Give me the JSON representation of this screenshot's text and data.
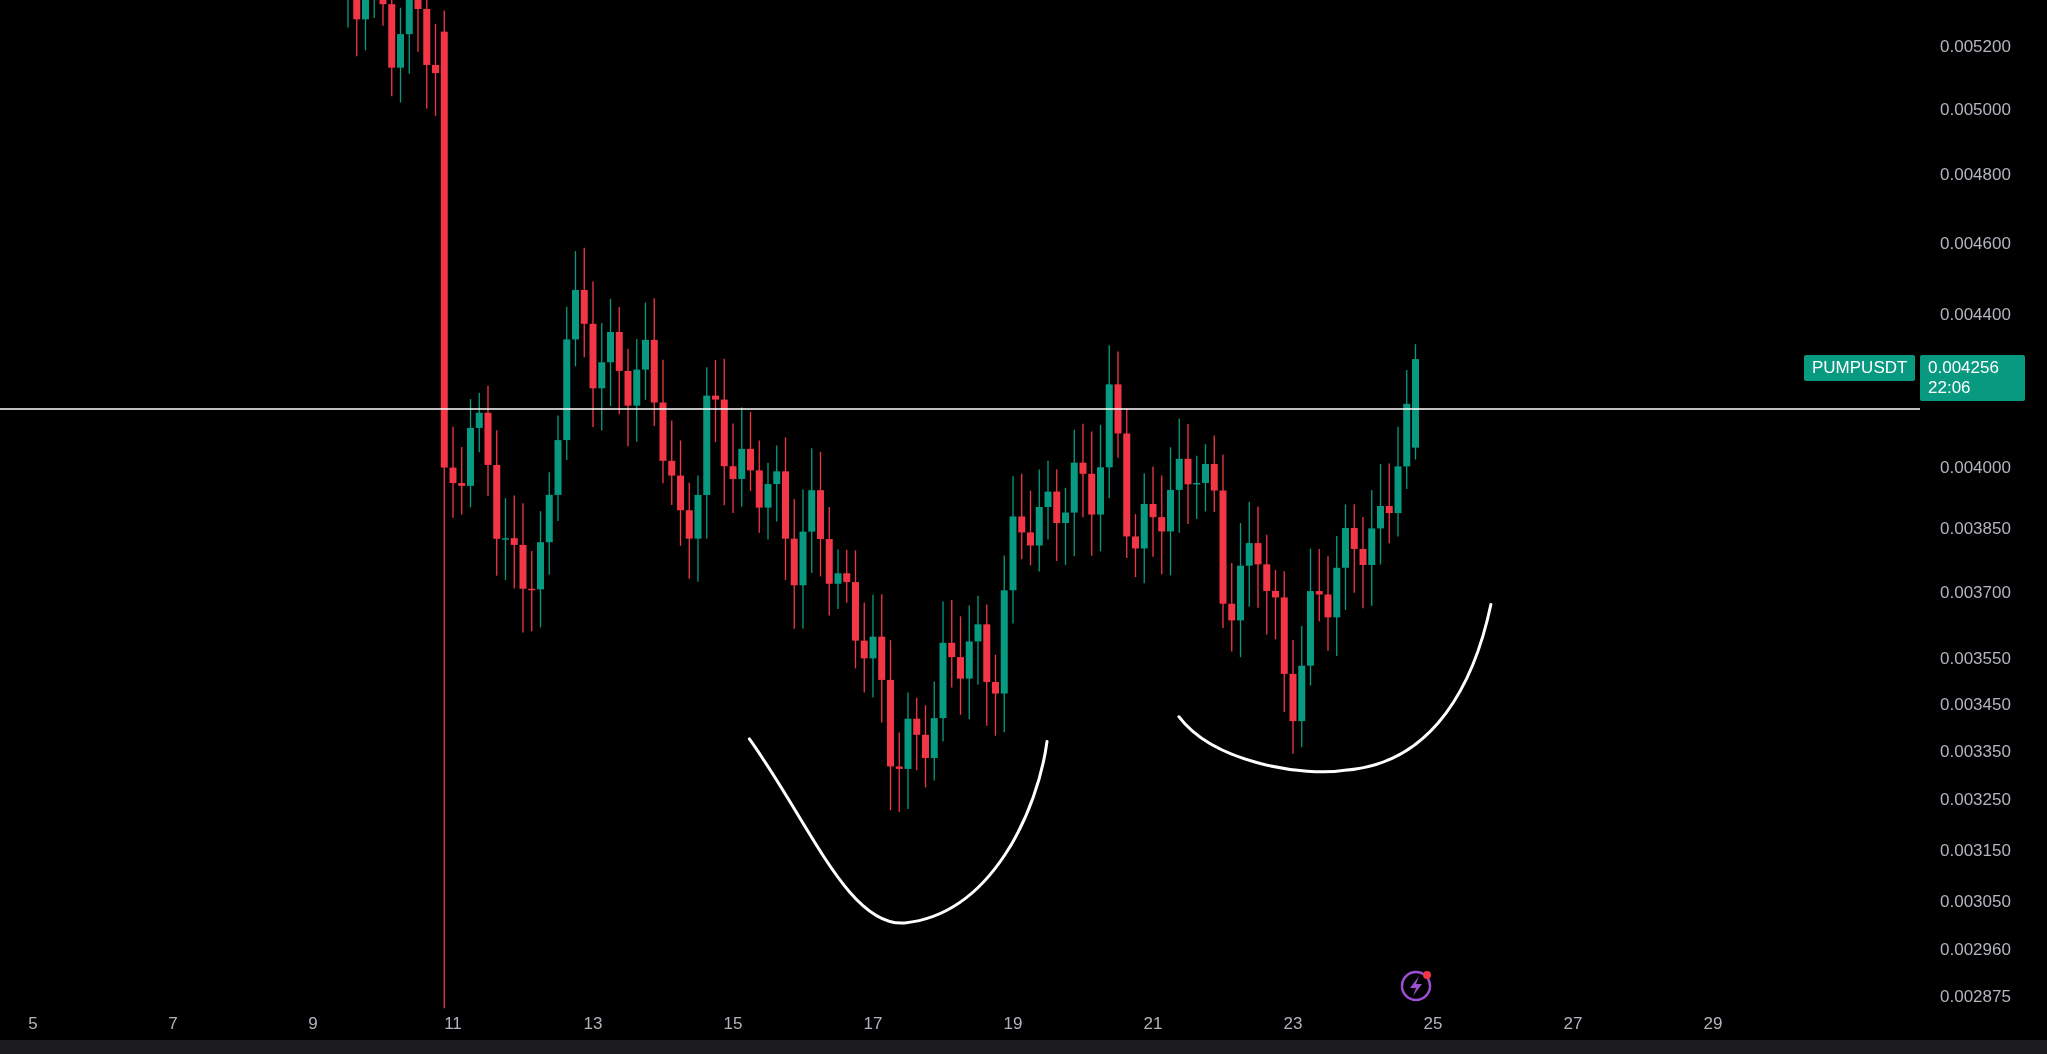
{
  "chart": {
    "symbol": "PUMPUSDT",
    "last_price": "0.004256",
    "countdown": "22:06",
    "price_axis": [
      "0.005200",
      "0.005000",
      "0.004800",
      "0.004600",
      "0.004400",
      "0.004000",
      "0.003850",
      "0.003700",
      "0.003550",
      "0.003450",
      "0.003350",
      "0.003250",
      "0.003150",
      "0.003050",
      "0.002960",
      "0.002875"
    ],
    "time_axis": [
      "5",
      "7",
      "9",
      "11",
      "13",
      "15",
      "17",
      "19",
      "21",
      "23",
      "25",
      "27",
      "29"
    ]
  }
}
